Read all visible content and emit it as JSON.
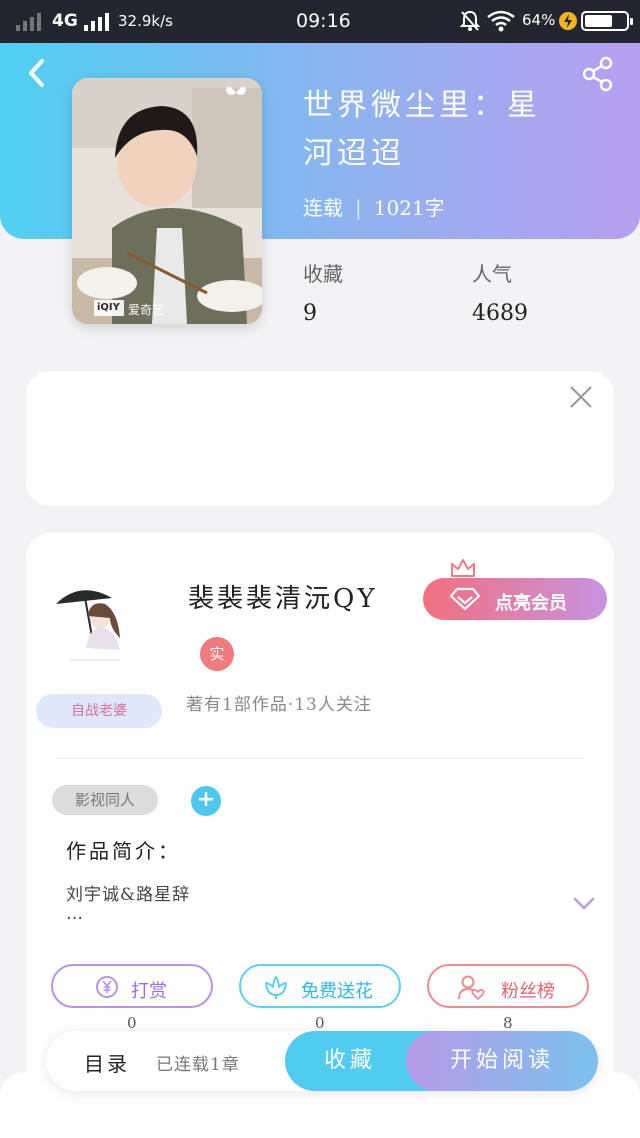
{
  "status_bar": {
    "network": "4G",
    "speed": "32.9k/s",
    "time": "09:16",
    "battery": "64%"
  },
  "book": {
    "title_line1": "世界微尘里：星",
    "title_line2": "河迢迢",
    "status": "连载",
    "word_count": "1021字",
    "stats": {
      "favorites_label": "收藏",
      "favorites_value": "9",
      "popularity_label": "人气",
      "popularity_value": "4689"
    },
    "cover_watermark": "爱奇艺",
    "cover_logo": "iQIY"
  },
  "author": {
    "name": "裴裴裴清沅QY",
    "real_badge": "实",
    "info": "著有1部作品·13人关注",
    "avatar_tag": "自战老婆",
    "vip_button": "点亮会员"
  },
  "intro": {
    "tag": "影视同人",
    "title": "作品简介：",
    "text": "刘宇诚&路星辞",
    "more": "…"
  },
  "actions": [
    {
      "label": "打赏",
      "count": "0"
    },
    {
      "label": "免费送花",
      "count": "0"
    },
    {
      "label": "粉丝榜",
      "count": "8"
    }
  ],
  "bottom": {
    "toc": "目录",
    "toc_status": "已连载1章",
    "favorite": "收藏",
    "read": "开始阅读"
  },
  "colors": {
    "hero_start": "#4fd0f2",
    "hero_end": "#b79ff0",
    "accent_blue": "#52cbf1",
    "accent_purple": "#b69ae8"
  }
}
